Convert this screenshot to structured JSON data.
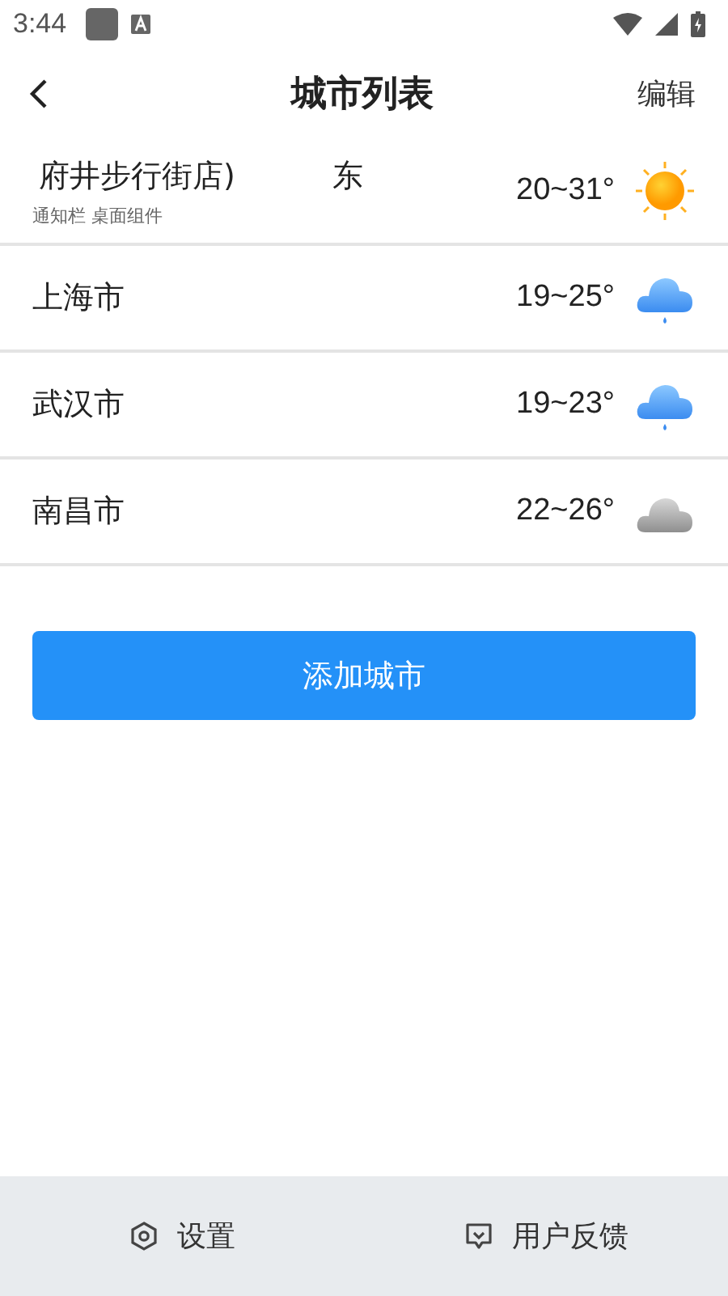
{
  "status_bar": {
    "time": "3:44"
  },
  "header": {
    "title": "城市列表",
    "action": "编辑"
  },
  "cities": [
    {
      "name": "府井步行街店)",
      "district": "东",
      "subtitle": "通知栏 桌面组件",
      "temp": "20~31°",
      "kind": "sunny"
    },
    {
      "name": "上海市",
      "temp": "19~25°",
      "kind": "rain"
    },
    {
      "name": "武汉市",
      "temp": "19~23°",
      "kind": "rain"
    },
    {
      "name": "南昌市",
      "temp": "22~26°",
      "kind": "cloudy"
    }
  ],
  "add_button": "添加城市",
  "bottom_bar": [
    {
      "label": "设置",
      "kind": "settings"
    },
    {
      "label": "用户反馈",
      "kind": "feedback"
    }
  ]
}
